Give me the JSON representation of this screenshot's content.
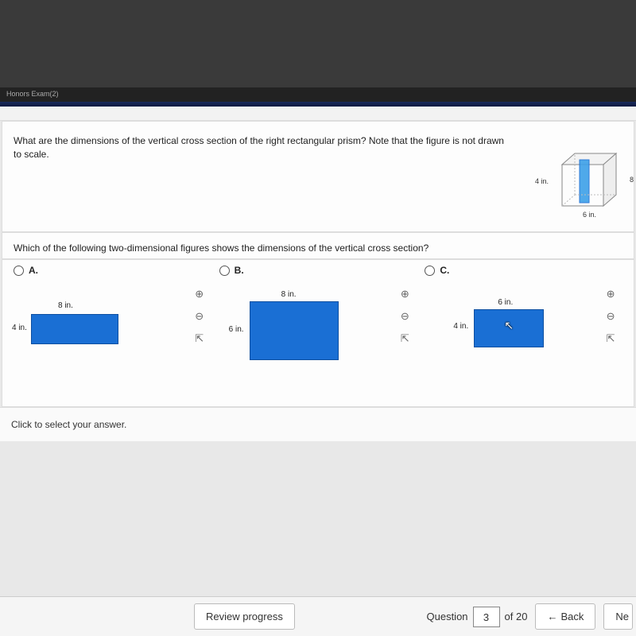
{
  "header_strip": "Honors Exam(2)",
  "question": "What are the dimensions of the vertical cross section of the right rectangular prism? Note that the figure is not drawn to scale.",
  "prism": {
    "height": "4 in.",
    "width": "6 in.",
    "depth": "8"
  },
  "sub_question": "Which of the following two-dimensional figures shows the dimensions of the vertical cross section?",
  "choices": {
    "a": {
      "label": "A.",
      "top_dim": "8 in.",
      "left_dim": "4 in."
    },
    "b": {
      "label": "B.",
      "top_dim": "8 in.",
      "left_dim": "6 in."
    },
    "c": {
      "label": "C.",
      "top_dim": "6 in.",
      "left_dim": "4 in."
    }
  },
  "tools": {
    "zoom_in": "⊕",
    "zoom_out": "⊖",
    "popout": "⇱"
  },
  "instruction": "Click to select your answer.",
  "footer": {
    "review": "Review progress",
    "question_label": "Question",
    "current": "3",
    "total": "of 20",
    "back": "Back",
    "next": "Ne"
  }
}
